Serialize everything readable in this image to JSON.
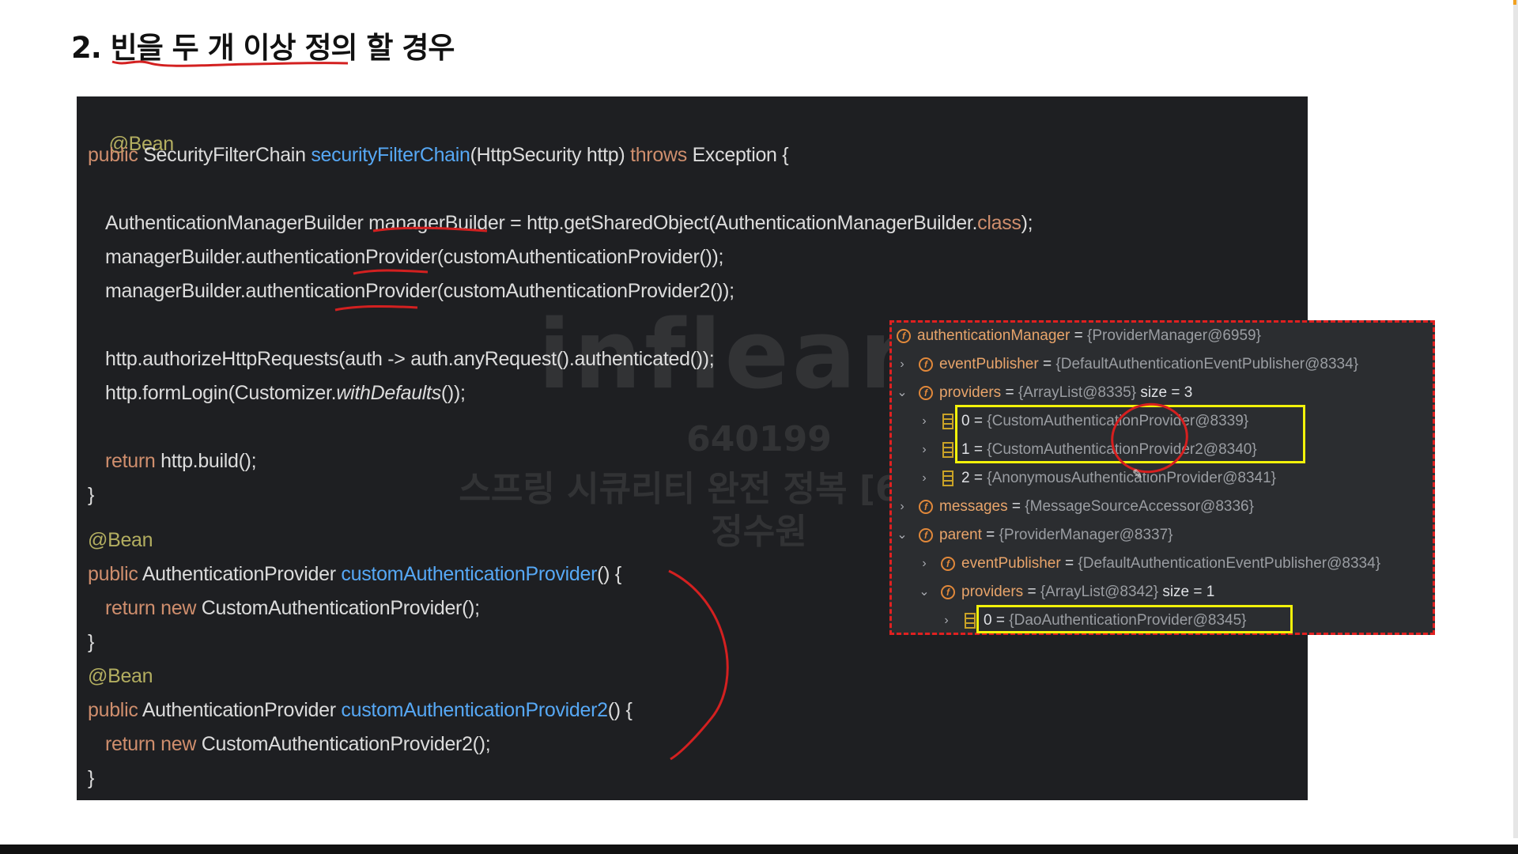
{
  "slide": {
    "title": "2. 빈을 두 개 이상 정의 할 경우"
  },
  "code": {
    "lines": [
      "@Bean",
      "public",
      "SecurityFilterChain",
      "securityFilterChain",
      "(HttpSecurity http)",
      "throws",
      "Exception {",
      "AuthenticationManagerBuilder managerBuilder = http.getSharedObject(AuthenticationManagerBuilder.",
      "class",
      ");",
      "managerBuilder.authenticationProvider(customAuthenticationProvider());",
      "managerBuilder.authenticationProvider(customAuthenticationProvider2());",
      "http.authorizeHttpRequests(auth -> auth.anyRequest().authenticated());",
      "http.formLogin(Customizer.",
      "withDefaults",
      "());",
      "return",
      "http.build();",
      "}",
      "AuthenticationProvider",
      "customAuthenticationProvider",
      "() {",
      "new",
      "CustomAuthenticationProvider();",
      "customAuthenticationProvider2",
      "CustomAuthenticationProvider2();"
    ]
  },
  "watermark": {
    "logo": "inflearn",
    "id": "640199",
    "course": "스프링 시큐리티 완전 정복 [6.x 개정판]",
    "name": "정수원"
  },
  "debugger": {
    "rows": [
      {
        "name": "authenticationManager",
        "value": "{ProviderManager@6959}",
        "extra": ""
      },
      {
        "name": "eventPublisher",
        "value": "{DefaultAuthenticationEventPublisher@8334}",
        "extra": ""
      },
      {
        "name": "providers",
        "value": "{ArrayList@8335}",
        "extra": "size = 3"
      },
      {
        "name": "0",
        "value": "{CustomAuthenticationProvider@8339}",
        "extra": ""
      },
      {
        "name": "1",
        "value": "{CustomAuthenticationProvider2@8340}",
        "extra": ""
      },
      {
        "name": "2",
        "value": "{AnonymousAuthenticationProvider@8341}",
        "extra": ""
      },
      {
        "name": "messages",
        "value": "{MessageSourceAccessor@8336}",
        "extra": ""
      },
      {
        "name": "parent",
        "value": "{ProviderManager@8337}",
        "extra": ""
      },
      {
        "name": "eventPublisher",
        "value": "{DefaultAuthenticationEventPublisher@8334}",
        "extra": ""
      },
      {
        "name": "providers",
        "value": "{ArrayList@8342}",
        "extra": "size = 1"
      },
      {
        "name": "0",
        "value": "{DaoAuthenticationProvider@8345}",
        "extra": ""
      }
    ],
    "equals": "="
  }
}
